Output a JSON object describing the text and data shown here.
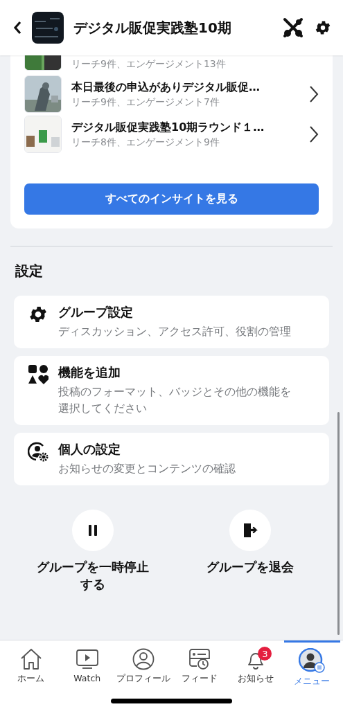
{
  "header": {
    "title": "デジタル販促実践塾10期"
  },
  "insights": {
    "posts": [
      {
        "kind": "partial",
        "subtitle": "リーチ9件、エンゲージメント13件"
      },
      {
        "kind": "full",
        "title": "本日最後の申込がありデジタル販促…",
        "subtitle": "リーチ9件、エンゲージメント7件"
      },
      {
        "kind": "full",
        "title": "デジタル販促実践塾10期ラウンド１…",
        "subtitle": "リーチ8件、エンゲージメント9件"
      }
    ],
    "button": "すべてのインサイトを見る"
  },
  "settings": {
    "heading": "設定",
    "items": [
      {
        "kind": "gear",
        "title": "グループ設定",
        "description": "ディスカッション、アクセス許可、役割の管理"
      },
      {
        "kind": "shapes",
        "title": "機能を追加",
        "description": "投稿のフォーマット、バッジとその他の機能を選択してください"
      },
      {
        "kind": "person",
        "title": "個人の設定",
        "description": "お知らせの変更とコンテンツの確認"
      }
    ]
  },
  "actions": [
    {
      "kind": "pause",
      "label": "グループを一時停止する"
    },
    {
      "kind": "leave",
      "label": "グループを退会"
    }
  ],
  "nav": [
    {
      "kind": "home",
      "label": "ホーム",
      "selected": false
    },
    {
      "kind": "watch",
      "label": "Watch",
      "selected": false
    },
    {
      "kind": "profile",
      "label": "プロフィール",
      "selected": false
    },
    {
      "kind": "feed",
      "label": "フィード",
      "selected": false
    },
    {
      "kind": "bell",
      "label": "お知らせ",
      "badge": "3",
      "selected": false
    },
    {
      "kind": "avatar",
      "label": "メニュー",
      "selected": true
    }
  ]
}
